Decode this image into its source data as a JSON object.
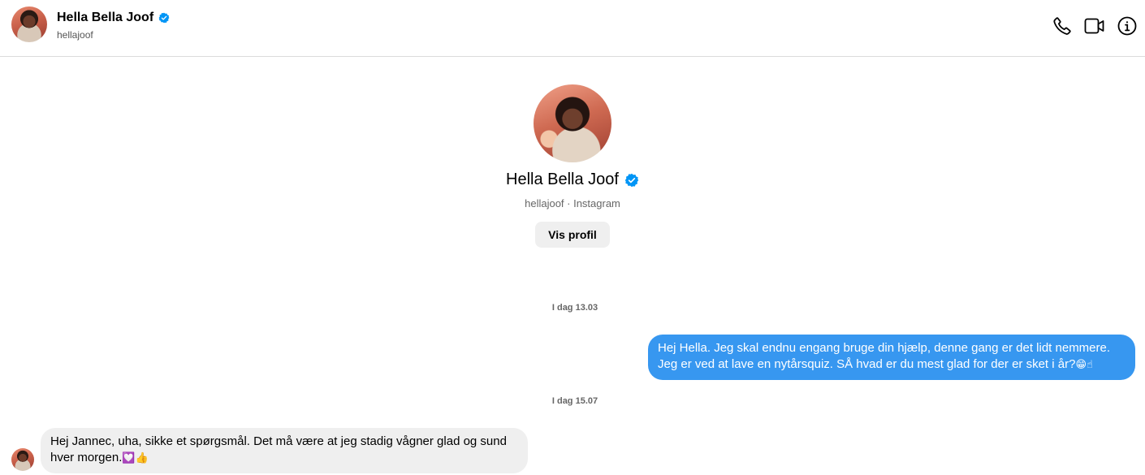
{
  "header": {
    "name": "Hella Bella Joof",
    "username": "hellajoof",
    "actions": [
      "phone-icon",
      "video-icon",
      "info-icon"
    ]
  },
  "profile": {
    "name": "Hella Bella Joof",
    "subtitle": "hellajoof · Instagram",
    "button_label": "Vis profil"
  },
  "thread": {
    "date_1": "I dag 13.03",
    "message_out_1": "Hej Hella. Jeg skal endnu engang bruge din hjælp, denne gang er det lidt nemmere. Jeg er ved at lave en nytårsquiz. SÅ hvad er du mest glad for der er sket i år?",
    "message_out_1_emoji": "😁☝",
    "date_2": "I dag 15.07",
    "message_in_1": "Hej Jannec, uha, sikke et spørgsmål. Det må være at jeg stadig vågner glad og sund hver morgen.",
    "message_in_1_emoji": "💟👍"
  },
  "colors": {
    "accent": "#3797f0",
    "verified": "#0095f6",
    "incoming_bubble": "#efefef",
    "divider": "#dbdbdb"
  }
}
